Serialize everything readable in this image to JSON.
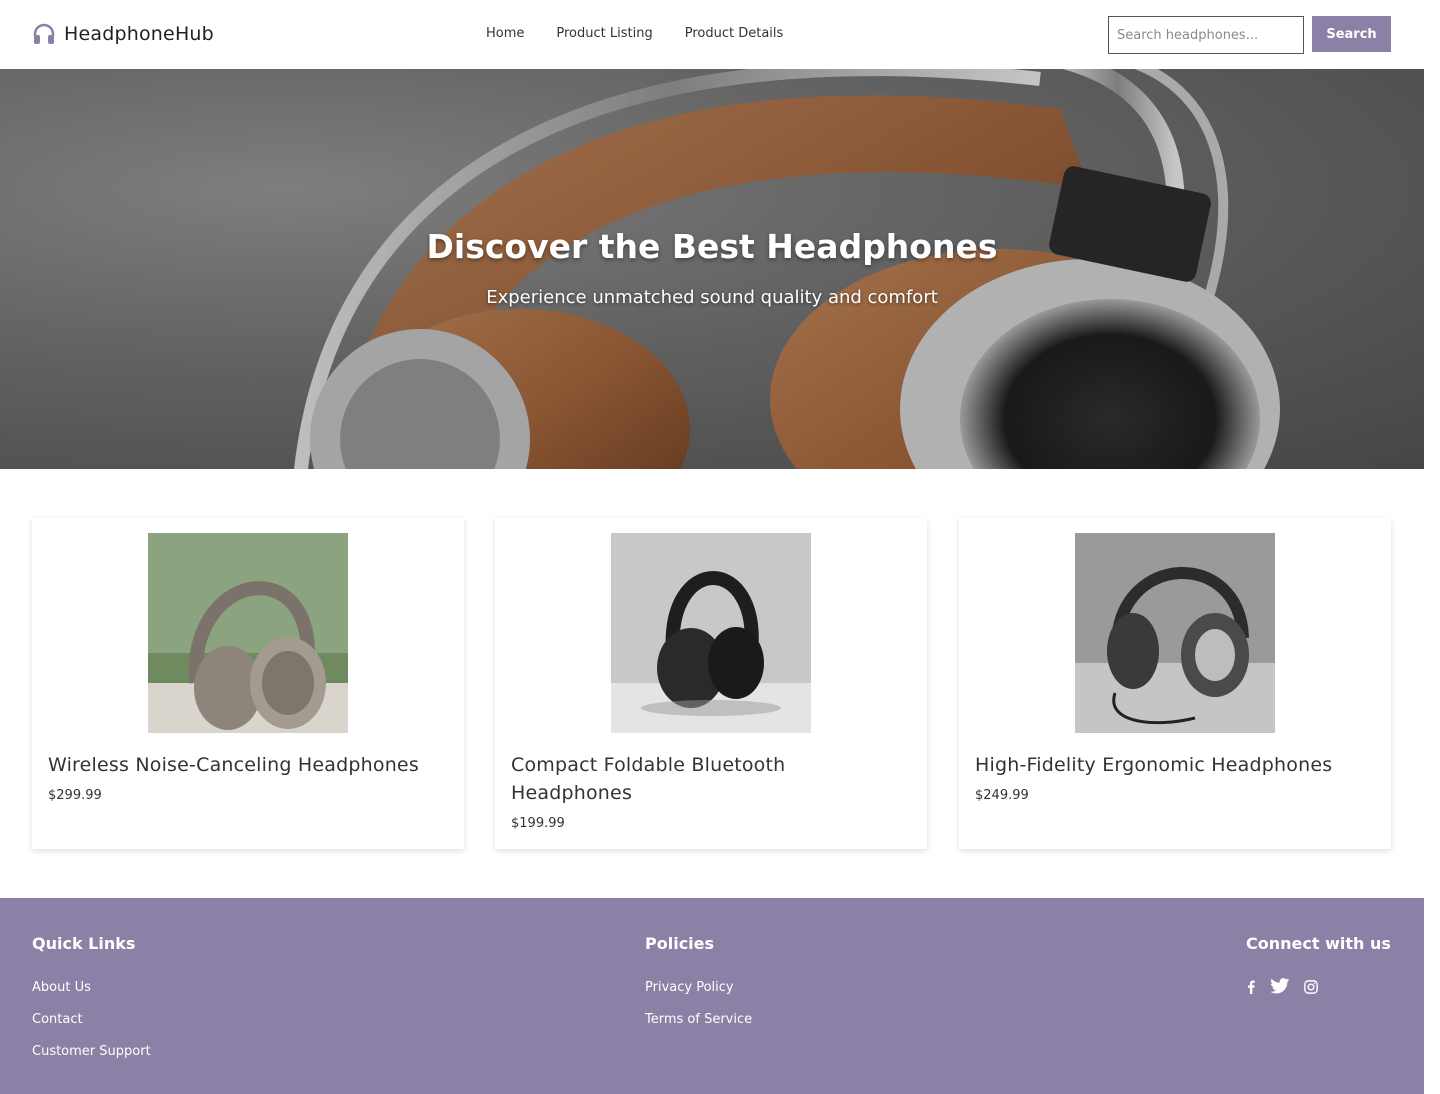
{
  "brand": {
    "name": "HeadphoneHub",
    "accent": "#8b80a6"
  },
  "nav": {
    "items": [
      {
        "label": "Home"
      },
      {
        "label": "Product Listing"
      },
      {
        "label": "Product Details"
      }
    ]
  },
  "search": {
    "placeholder": "Search headphones...",
    "value": "",
    "button_label": "Search"
  },
  "hero": {
    "title": "Discover the Best Headphones",
    "subtitle": "Experience unmatched sound quality and comfort"
  },
  "products": [
    {
      "name": "Wireless Noise-Canceling Headphones",
      "price": "$299.99"
    },
    {
      "name": "Compact Foldable Bluetooth Headphones",
      "price": "$199.99"
    },
    {
      "name": "High-Fidelity Ergonomic Headphones",
      "price": "$249.99"
    }
  ],
  "footer": {
    "quick_links": {
      "heading": "Quick Links",
      "items": [
        "About Us",
        "Contact",
        "Customer Support"
      ]
    },
    "policies": {
      "heading": "Policies",
      "items": [
        "Privacy Policy",
        "Terms of Service"
      ]
    },
    "connect": {
      "heading": "Connect with us",
      "icons": [
        "facebook-icon",
        "twitter-icon",
        "instagram-icon"
      ]
    }
  }
}
